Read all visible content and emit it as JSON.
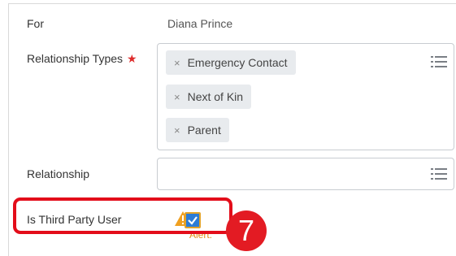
{
  "form": {
    "for_label": "For",
    "for_value": "Diana Prince",
    "relationship_types_label": "Relationship Types",
    "required_marker": "★",
    "relationship_types": [
      {
        "label": "Emergency Contact"
      },
      {
        "label": "Next of Kin"
      },
      {
        "label": "Parent"
      }
    ],
    "remove_glyph": "×",
    "relationship_label": "Relationship",
    "relationship_value": "",
    "third_party_label": "Is Third Party User",
    "third_party_checked": true,
    "alert_text": "Alert:"
  },
  "annotation": {
    "step_number": "7",
    "highlight_color": "#e30d1a",
    "badge_color": "#e31b23"
  },
  "icons": {
    "list": "prompt-list-icon",
    "warning": "warning-triangle-icon",
    "check": "check-icon"
  },
  "colors": {
    "required": "#de2b2b",
    "checkbox_fill": "#2c7cd6",
    "checkbox_border": "#e2a32a",
    "alert": "#e38d13",
    "pill_bg": "#e8ebee"
  }
}
